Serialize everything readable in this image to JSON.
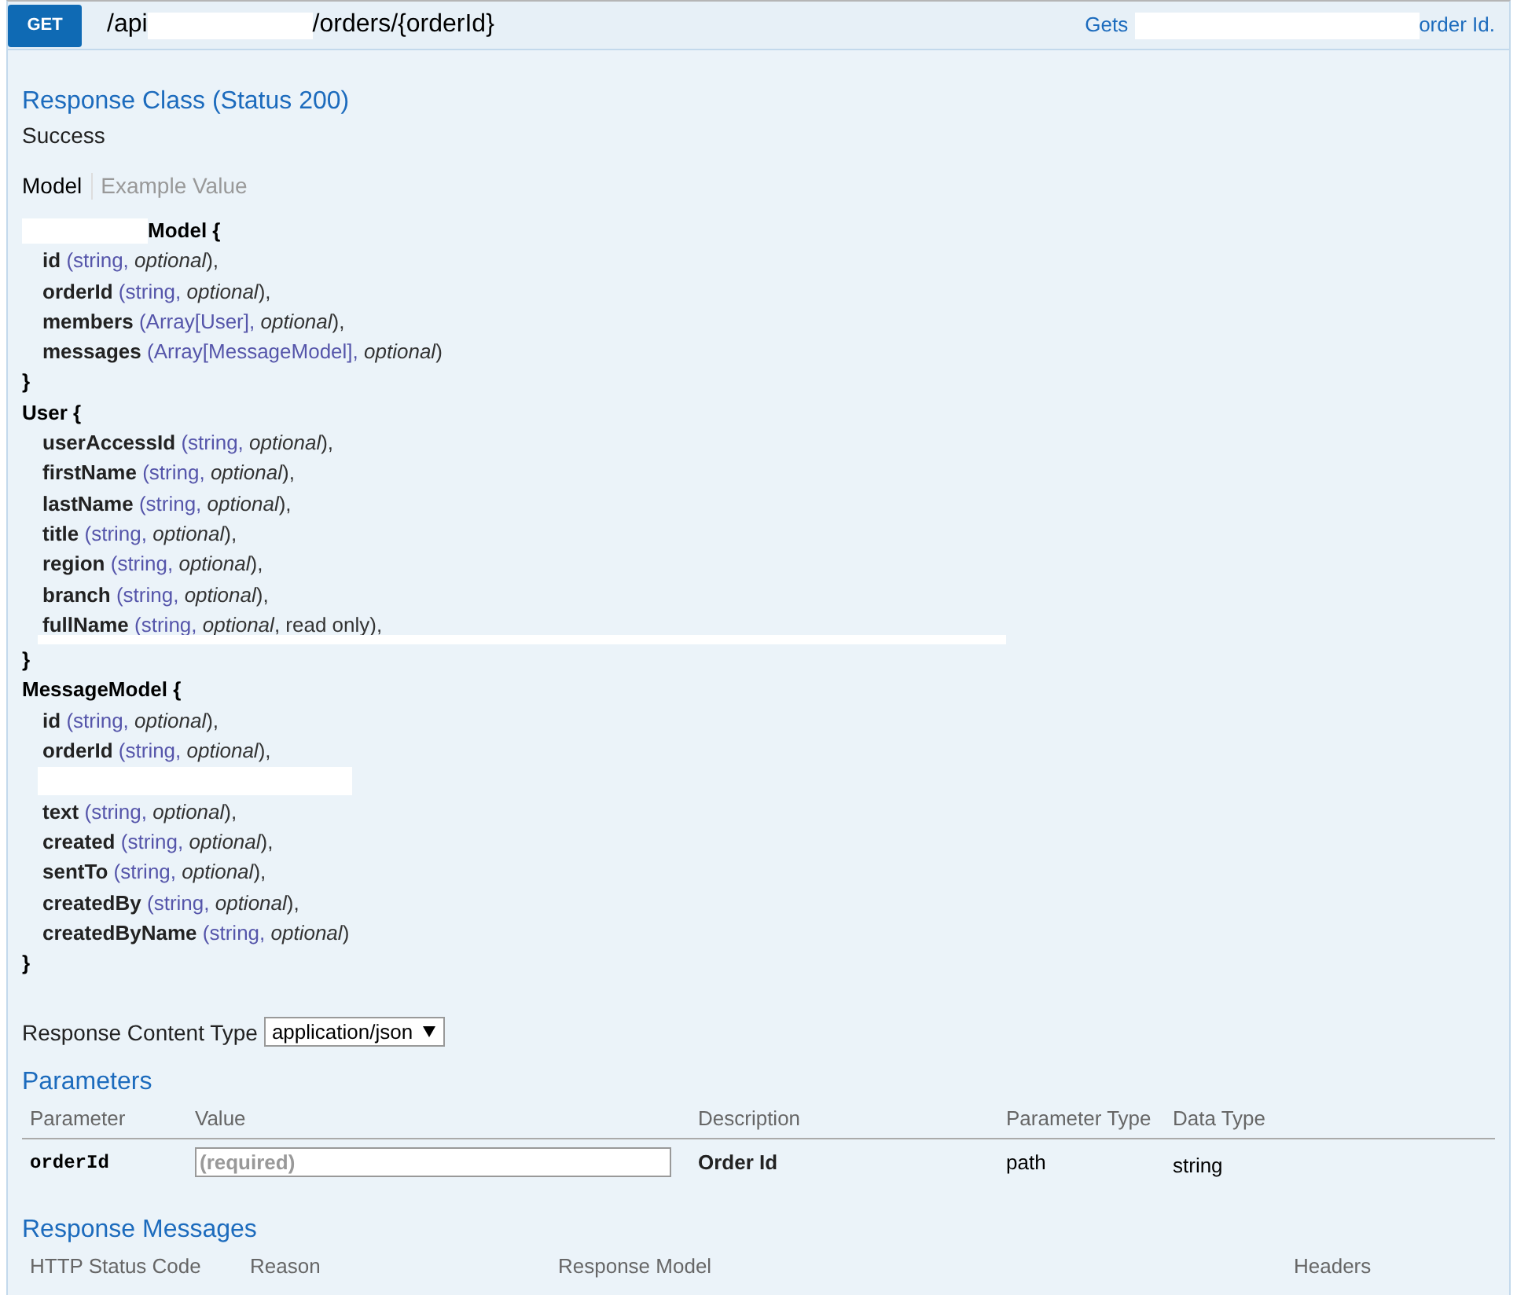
{
  "operation": {
    "method": "GET",
    "path": [
      {
        "kind": "text",
        "text": "/api"
      },
      {
        "kind": "redacted"
      },
      {
        "kind": "text",
        "text": "/orders/{orderId}"
      }
    ],
    "summary": [
      {
        "kind": "text",
        "text": "Gets"
      },
      {
        "kind": "redacted"
      },
      {
        "kind": "text",
        "text": "order Id."
      }
    ]
  },
  "response_class": {
    "title": "Response Class (Status 200)",
    "description": "Success"
  },
  "model_tabs": [
    {
      "label": "Model",
      "selected": true
    },
    {
      "label": "Example Value",
      "selected": false
    }
  ],
  "models": [
    {
      "header": [
        {
          "kind": "redacted"
        },
        {
          "kind": "text",
          "text": "Model {"
        }
      ],
      "properties": [
        {
          "kind": "property",
          "name": "id",
          "type": "(string,",
          "flags": "optional",
          "tail": "),"
        },
        {
          "kind": "property",
          "name": "orderId",
          "type": "(string,",
          "flags": "optional",
          "tail": "),"
        },
        {
          "kind": "property",
          "name": "members",
          "type": "(Array[User],",
          "flags": "optional",
          "tail": "),"
        },
        {
          "kind": "property",
          "name": "messages",
          "type": "(Array[MessageModel],",
          "flags": "optional",
          "tail": ")"
        }
      ],
      "close": "}"
    },
    {
      "header": [
        {
          "kind": "text",
          "text": "User {"
        }
      ],
      "properties": [
        {
          "kind": "property",
          "name": "userAccessId",
          "type": "(string,",
          "flags": "optional",
          "tail": "),"
        },
        {
          "kind": "property",
          "name": "firstName",
          "type": "(string,",
          "flags": "optional",
          "tail": "),"
        },
        {
          "kind": "property",
          "name": "lastName",
          "type": "(string,",
          "flags": "optional",
          "tail": "),"
        },
        {
          "kind": "property",
          "name": "title",
          "type": "(string,",
          "flags": "optional",
          "tail": "),"
        },
        {
          "kind": "property",
          "name": "region",
          "type": "(string,",
          "flags": "optional",
          "tail": "),"
        },
        {
          "kind": "property",
          "name": "branch",
          "type": "(string,",
          "flags": "optional",
          "tail": "),"
        },
        {
          "kind": "property",
          "name": "fullName",
          "type": "(string,",
          "flags": "optional",
          "tail": ", read only),"
        },
        {
          "kind": "redacted_strip"
        }
      ],
      "close": "}"
    },
    {
      "header": [
        {
          "kind": "text",
          "text": "MessageModel {"
        }
      ],
      "properties": [
        {
          "kind": "property",
          "name": "id",
          "type": "(string,",
          "flags": "optional",
          "tail": "),"
        },
        {
          "kind": "property",
          "name": "orderId",
          "type": "(string,",
          "flags": "optional",
          "tail": "),"
        },
        {
          "kind": "redacted"
        },
        {
          "kind": "property",
          "name": "text",
          "type": "(string,",
          "flags": "optional",
          "tail": "),"
        },
        {
          "kind": "property",
          "name": "created",
          "type": "(string,",
          "flags": "optional",
          "tail": "),"
        },
        {
          "kind": "property",
          "name": "sentTo",
          "type": "(string,",
          "flags": "optional",
          "tail": "),"
        },
        {
          "kind": "property",
          "name": "createdBy",
          "type": "(string,",
          "flags": "optional",
          "tail": "),"
        },
        {
          "kind": "property",
          "name": "createdByName",
          "type": "(string,",
          "flags": "optional",
          "tail": ")"
        }
      ],
      "close": "}"
    }
  ],
  "response_content_type": {
    "label": "Response Content Type",
    "value": "application/json"
  },
  "parameters": {
    "title": "Parameters",
    "columns": [
      "Parameter",
      "Value",
      "Description",
      "Parameter Type",
      "Data Type"
    ],
    "rows": [
      {
        "name": "orderId",
        "placeholder": "(required)",
        "description": "Order Id",
        "parameter_type": "path",
        "data_type": "string"
      }
    ]
  },
  "response_messages": {
    "title": "Response Messages",
    "columns": [
      "HTTP Status Code",
      "Reason",
      "Response Model",
      "Headers"
    ]
  }
}
